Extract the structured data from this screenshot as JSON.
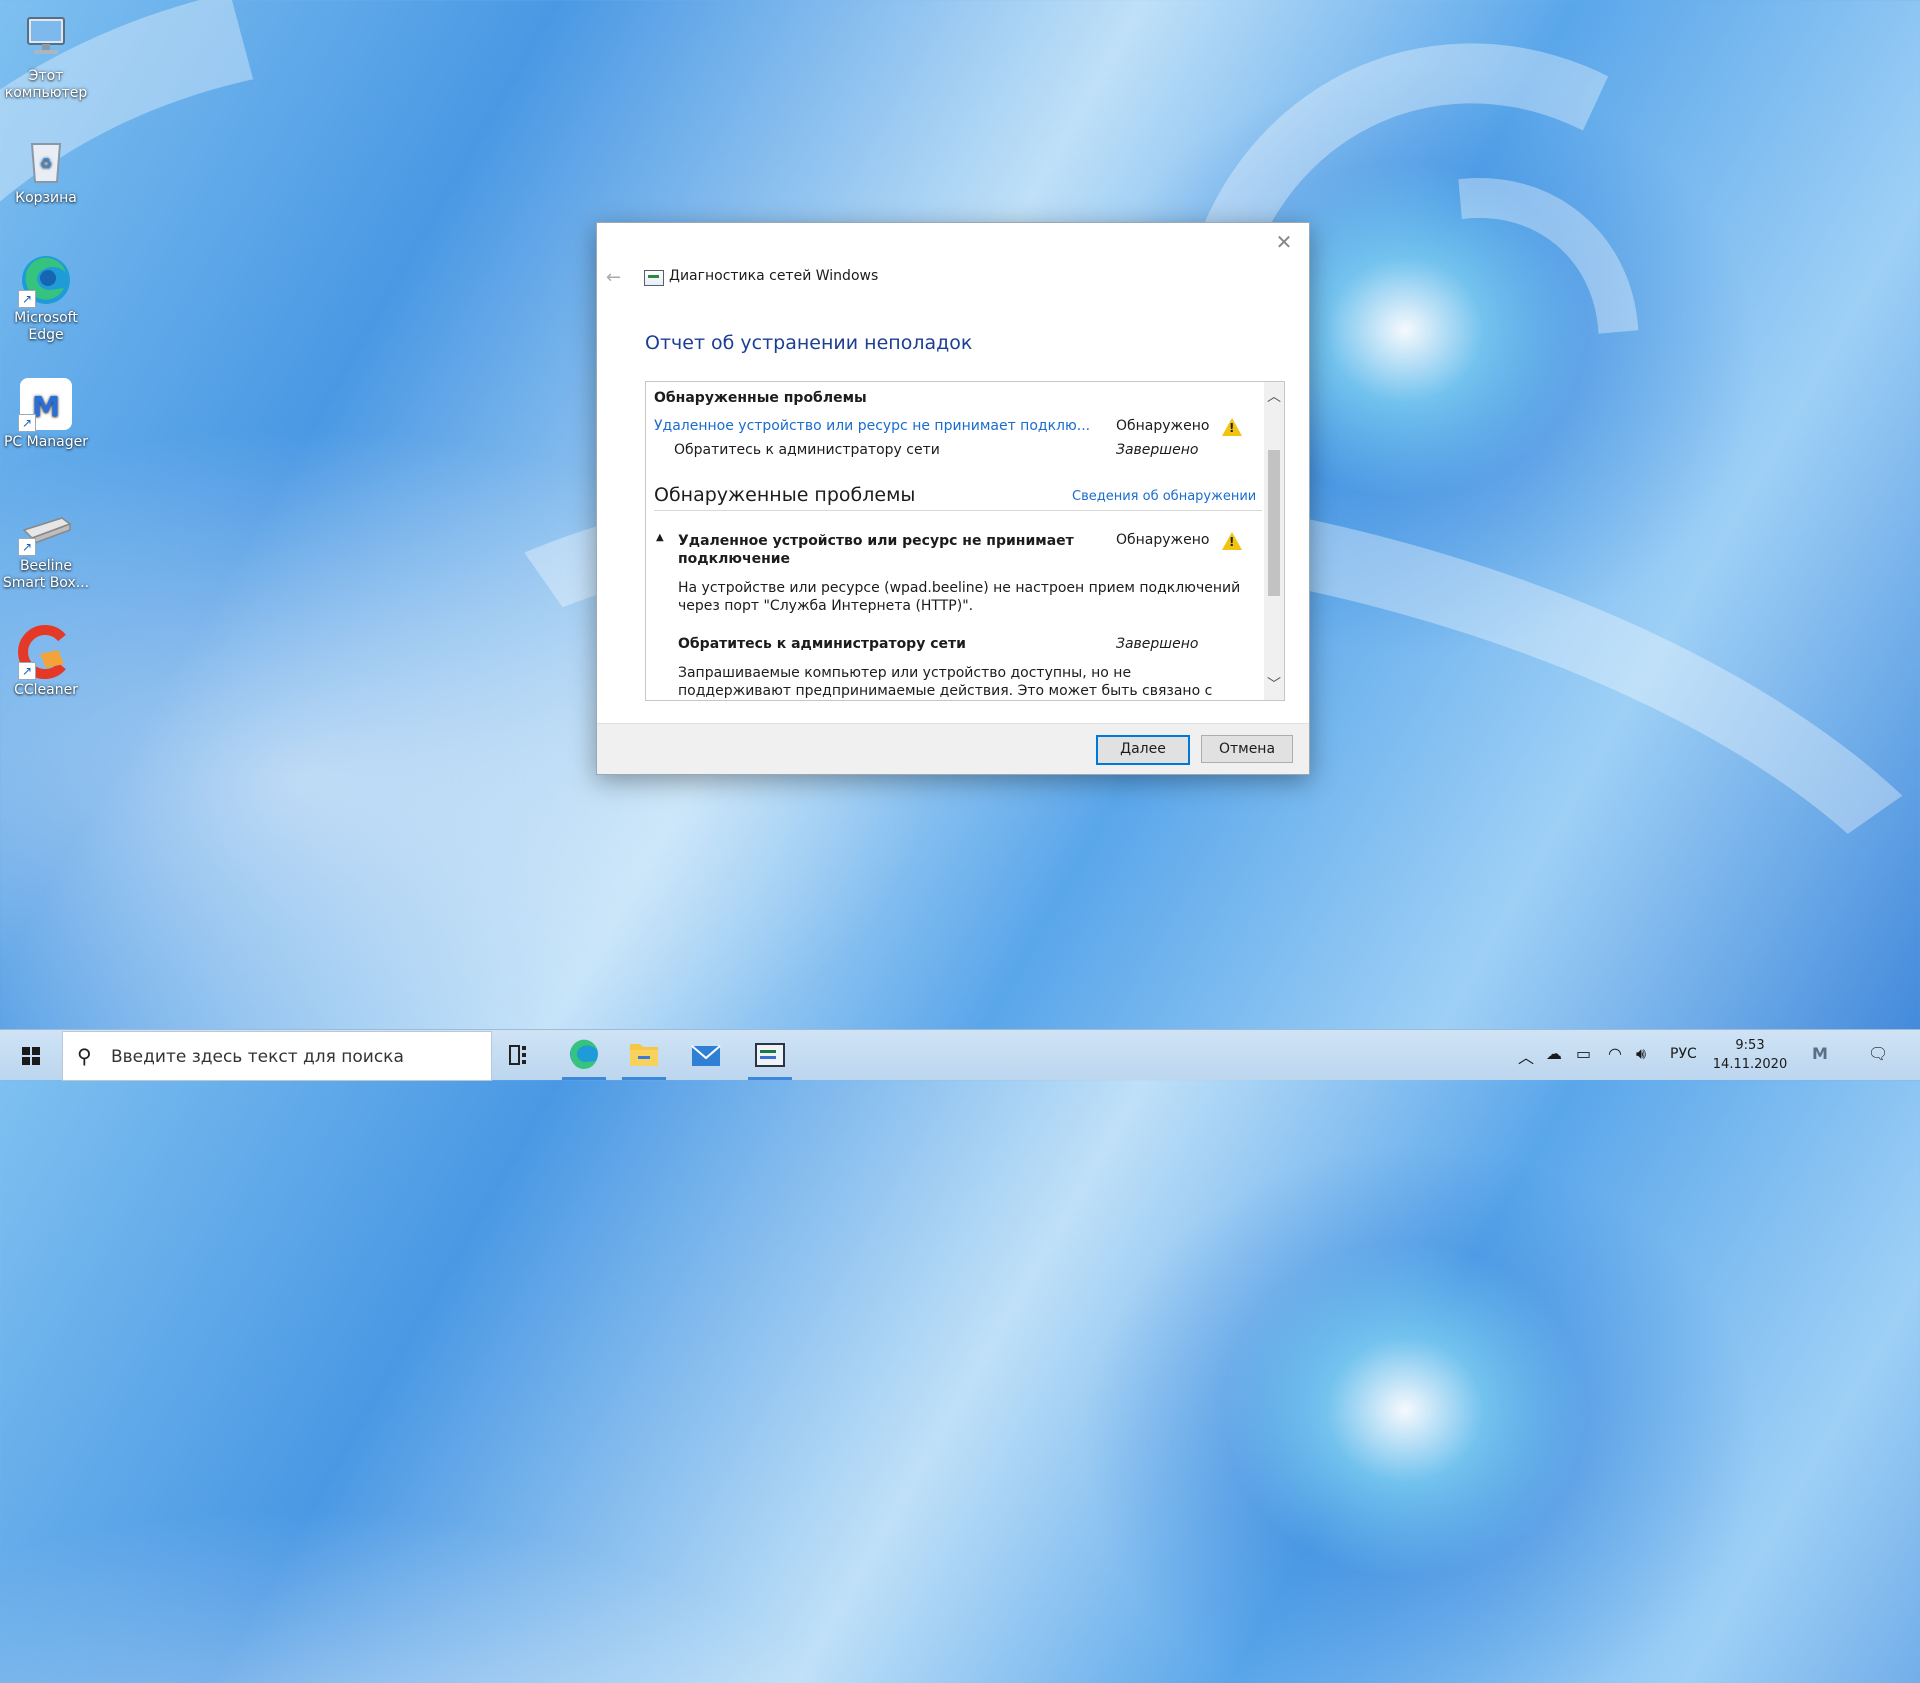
{
  "desktop": {
    "icons": [
      {
        "label": "Этот компьютер",
        "icon": "computer-icon"
      },
      {
        "label": "Корзина",
        "icon": "recycle-bin-icon"
      },
      {
        "label": "Microsoft Edge",
        "icon": "edge-icon"
      },
      {
        "label": "PC Manager",
        "icon": "pc-manager-icon"
      },
      {
        "label": "Beeline Smart Box...",
        "icon": "router-icon"
      },
      {
        "label": "CCleaner",
        "icon": "ccleaner-icon"
      }
    ]
  },
  "dialog": {
    "app_title": "Диагностика сетей Windows",
    "heading": "Отчет об устранении неполадок",
    "summary": {
      "section_title": "Обнаруженные проблемы",
      "problem_link": "Удаленное устройство или ресурс не принимает подклю...",
      "problem_status": "Обнаружено",
      "action": "Обратитесь к администратору сети",
      "action_status": "Завершено"
    },
    "details": {
      "section_title": "Обнаруженные проблемы",
      "details_link": "Сведения об обнаружении",
      "problem_title_line1": "Удаленное устройство или ресурс не принимает",
      "problem_title_line2": "подключение",
      "problem_status": "Обнаружено",
      "problem_desc_line1": "На устройстве или ресурсе (wpad.beeline) не настроен прием подключений",
      "problem_desc_line2": "через порт \"Служба Интернета (HTTP)\".",
      "action_title": "Обратитесь к администратору сети",
      "action_status": "Завершено",
      "action_desc_line1": "Запрашиваемые компьютер или устройство доступны, но не",
      "action_desc_line2": "поддерживают предпринимаемые действия. Это может быть связано с"
    },
    "buttons": {
      "next": "Далее",
      "cancel": "Отмена"
    }
  },
  "taskbar": {
    "search_placeholder": "Введите здесь текст для поиска",
    "pinned": [
      "task-view-icon",
      "edge-icon",
      "file-explorer-icon",
      "mail-icon",
      "network-diagnostics-icon"
    ],
    "language": "РУС",
    "time": "9:53",
    "date": "14.11.2020"
  },
  "colors": {
    "accent": "#0078d7",
    "heading": "#1c3f94",
    "link": "#1a6dcc",
    "warning": "#f1c40f"
  }
}
